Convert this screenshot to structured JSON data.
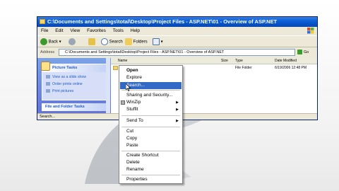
{
  "window": {
    "title": "C:\\Documents and Settings\\total\\Desktop\\Project Files - ASP.NET\\01 - Overview of ASP.NET"
  },
  "menubar": [
    "File",
    "Edit",
    "View",
    "Favorites",
    "Tools",
    "Help"
  ],
  "toolbar": {
    "back_label": "Back",
    "search_label": "Search",
    "folders_label": "Folders"
  },
  "address": {
    "label": "Address",
    "value": "C:\\Documents and Settings\\total\\Desktop\\Project Files - ASP.NET\\01 - Overview of ASP.NET",
    "go_label": "Go"
  },
  "left_pane": {
    "picture_tasks": {
      "header": "Picture Tasks",
      "items": [
        "View as a slide show",
        "Order prints online",
        "Print pictures"
      ]
    },
    "file_folder_tasks_header": "File and Folder Tasks"
  },
  "file_list": {
    "columns": [
      "Name",
      "Size",
      "Type",
      "Date Modified"
    ],
    "rows": [
      {
        "type": "File Folder",
        "date": "6/19/2006 12:48 PM"
      }
    ]
  },
  "status_bar": {
    "text": "Search..."
  },
  "context_menu": {
    "items": [
      {
        "label": "Open",
        "bold": true
      },
      {
        "label": "Explore"
      },
      {
        "label": "Search...",
        "highlighted": true
      },
      {
        "label": "Sharing and Security..."
      },
      {
        "label": "WinZip",
        "submenu": true
      },
      {
        "label": "Stuffit",
        "submenu": true
      },
      {
        "label": "Send To",
        "submenu": true
      },
      {
        "label": "Cut"
      },
      {
        "label": "Copy"
      },
      {
        "label": "Paste"
      },
      {
        "label": "Create Shortcut"
      },
      {
        "label": "Delete"
      },
      {
        "label": "Rename"
      },
      {
        "label": "Properties"
      }
    ]
  },
  "colors": {
    "titlebar": "#0a5fd8",
    "menu_highlight": "#316ac5",
    "task_pane": "#6375d6"
  }
}
